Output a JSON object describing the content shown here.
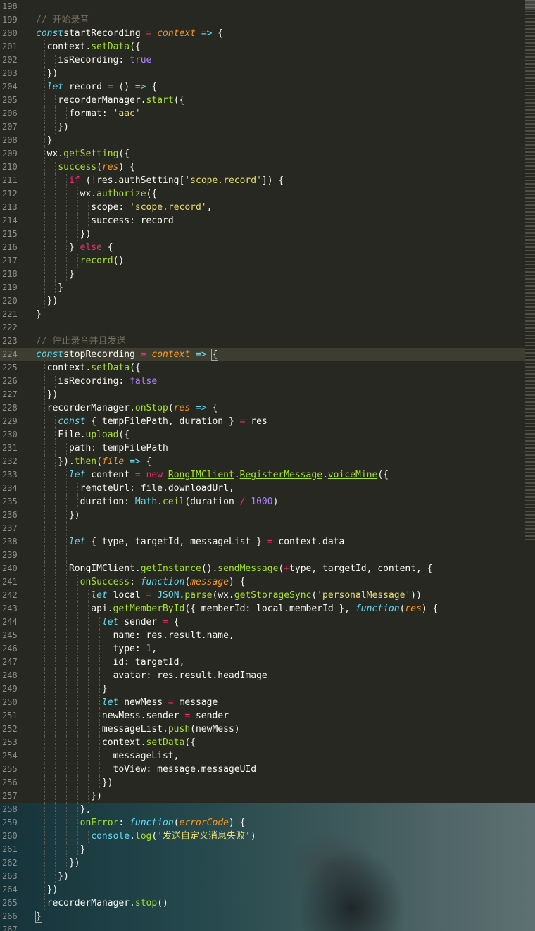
{
  "editor": {
    "current_line": 224,
    "lines": [
      {
        "n": "198",
        "i": 0,
        "t": []
      },
      {
        "n": "199",
        "i": 0,
        "t": [
          [
            "c",
            "// 开始录音"
          ]
        ]
      },
      {
        "n": "200",
        "i": 0,
        "t": [
          [
            "k",
            "const"
          ],
          [
            "",
            "startRecording "
          ],
          [
            "r",
            "="
          ],
          [
            "",
            " "
          ],
          [
            "p",
            "context"
          ],
          [
            "",
            " "
          ],
          [
            "k",
            "=>"
          ],
          [
            "",
            " {"
          ]
        ]
      },
      {
        "n": "201",
        "i": 1,
        "t": [
          [
            "",
            "  context."
          ],
          [
            "f",
            "setData"
          ],
          [
            "",
            "({"
          ]
        ]
      },
      {
        "n": "202",
        "i": 2,
        "t": [
          [
            "",
            "    isRecording: "
          ],
          [
            "n",
            "true"
          ]
        ]
      },
      {
        "n": "203",
        "i": 1,
        "t": [
          [
            "",
            "  })"
          ]
        ]
      },
      {
        "n": "204",
        "i": 1,
        "t": [
          [
            "",
            "  "
          ],
          [
            "k",
            "let"
          ],
          [
            "",
            " record "
          ],
          [
            "r",
            "="
          ],
          [
            "",
            " () "
          ],
          [
            "k",
            "=>"
          ],
          [
            "",
            " {"
          ]
        ]
      },
      {
        "n": "205",
        "i": 2,
        "t": [
          [
            "",
            "    recorderManager."
          ],
          [
            "f",
            "start"
          ],
          [
            "",
            "({"
          ]
        ]
      },
      {
        "n": "206",
        "i": 3,
        "t": [
          [
            "",
            "      format: "
          ],
          [
            "s",
            "'aac'"
          ]
        ]
      },
      {
        "n": "207",
        "i": 2,
        "t": [
          [
            "",
            "    })"
          ]
        ]
      },
      {
        "n": "208",
        "i": 1,
        "t": [
          [
            "",
            "  }"
          ]
        ]
      },
      {
        "n": "209",
        "i": 1,
        "t": [
          [
            "",
            "  wx."
          ],
          [
            "f",
            "getSetting"
          ],
          [
            "",
            "({"
          ]
        ]
      },
      {
        "n": "210",
        "i": 2,
        "t": [
          [
            "",
            "    "
          ],
          [
            "f",
            "success"
          ],
          [
            "",
            "("
          ],
          [
            "p",
            "res"
          ],
          [
            "",
            ") {"
          ]
        ]
      },
      {
        "n": "211",
        "i": 3,
        "t": [
          [
            "",
            "      "
          ],
          [
            "r",
            "if"
          ],
          [
            "",
            " ("
          ],
          [
            "r",
            "!"
          ],
          [
            "",
            "res.authSetting["
          ],
          [
            "s",
            "'scope.record'"
          ],
          [
            "",
            "]) {"
          ]
        ]
      },
      {
        "n": "212",
        "i": 4,
        "t": [
          [
            "",
            "        wx."
          ],
          [
            "f",
            "authorize"
          ],
          [
            "",
            "({"
          ]
        ]
      },
      {
        "n": "213",
        "i": 5,
        "t": [
          [
            "",
            "          scope: "
          ],
          [
            "s",
            "'scope.record'"
          ],
          [
            "",
            ","
          ]
        ]
      },
      {
        "n": "214",
        "i": 5,
        "t": [
          [
            "",
            "          success: record"
          ]
        ]
      },
      {
        "n": "215",
        "i": 4,
        "t": [
          [
            "",
            "        })"
          ]
        ]
      },
      {
        "n": "216",
        "i": 3,
        "t": [
          [
            "",
            "      } "
          ],
          [
            "r",
            "else"
          ],
          [
            "",
            " {"
          ]
        ]
      },
      {
        "n": "217",
        "i": 4,
        "t": [
          [
            "",
            "        "
          ],
          [
            "f",
            "record"
          ],
          [
            "",
            "()"
          ]
        ]
      },
      {
        "n": "218",
        "i": 3,
        "t": [
          [
            "",
            "      }"
          ]
        ]
      },
      {
        "n": "219",
        "i": 2,
        "t": [
          [
            "",
            "    }"
          ]
        ]
      },
      {
        "n": "220",
        "i": 1,
        "t": [
          [
            "",
            "  })"
          ]
        ]
      },
      {
        "n": "221",
        "i": 0,
        "t": [
          [
            "",
            "}"
          ]
        ]
      },
      {
        "n": "222",
        "i": 0,
        "t": []
      },
      {
        "n": "223",
        "i": 0,
        "t": [
          [
            "c",
            "// 停止录音并且发送"
          ]
        ]
      },
      {
        "n": "224",
        "i": 0,
        "t": [
          [
            "k",
            "const"
          ],
          [
            "",
            "stopRecording "
          ],
          [
            "r",
            "="
          ],
          [
            "",
            " "
          ],
          [
            "p",
            "context"
          ],
          [
            "",
            " "
          ],
          [
            "k",
            "=>"
          ],
          [
            "",
            " "
          ],
          [
            "ou",
            "{"
          ]
        ]
      },
      {
        "n": "225",
        "i": 1,
        "t": [
          [
            "",
            "  context."
          ],
          [
            "f",
            "setData"
          ],
          [
            "",
            "({"
          ]
        ]
      },
      {
        "n": "226",
        "i": 2,
        "t": [
          [
            "",
            "    isRecording: "
          ],
          [
            "n",
            "false"
          ]
        ]
      },
      {
        "n": "227",
        "i": 1,
        "t": [
          [
            "",
            "  })"
          ]
        ]
      },
      {
        "n": "228",
        "i": 1,
        "t": [
          [
            "",
            "  recorderManager."
          ],
          [
            "f",
            "onStop"
          ],
          [
            "",
            "("
          ],
          [
            "p",
            "res"
          ],
          [
            "",
            " "
          ],
          [
            "k",
            "=>"
          ],
          [
            "",
            " {"
          ]
        ]
      },
      {
        "n": "229",
        "i": 2,
        "t": [
          [
            "",
            "    "
          ],
          [
            "k",
            "const"
          ],
          [
            "",
            " { tempFilePath, duration } "
          ],
          [
            "r",
            "="
          ],
          [
            "",
            " res"
          ]
        ]
      },
      {
        "n": "230",
        "i": 2,
        "t": [
          [
            "",
            "    File."
          ],
          [
            "f",
            "upload"
          ],
          [
            "",
            "({"
          ]
        ]
      },
      {
        "n": "231",
        "i": 3,
        "t": [
          [
            "",
            "      path: tempFilePath"
          ]
        ]
      },
      {
        "n": "232",
        "i": 2,
        "t": [
          [
            "",
            "    })."
          ],
          [
            "f",
            "then"
          ],
          [
            "",
            "("
          ],
          [
            "p",
            "file"
          ],
          [
            "",
            " "
          ],
          [
            "k",
            "=>"
          ],
          [
            "",
            " {"
          ]
        ]
      },
      {
        "n": "233",
        "i": 3,
        "t": [
          [
            "",
            "      "
          ],
          [
            "k",
            "let"
          ],
          [
            "",
            " content "
          ],
          [
            "r",
            "="
          ],
          [
            "",
            " "
          ],
          [
            "r",
            "new"
          ],
          [
            "",
            " "
          ],
          [
            "cl",
            "RongIMClient"
          ],
          [
            "",
            "."
          ],
          [
            "cl",
            "RegisterMessage"
          ],
          [
            "",
            "."
          ],
          [
            "cl",
            "voiceMine"
          ],
          [
            "",
            "({"
          ]
        ]
      },
      {
        "n": "234",
        "i": 4,
        "t": [
          [
            "",
            "        remoteUrl: file.downloadUrl,"
          ]
        ]
      },
      {
        "n": "235",
        "i": 4,
        "t": [
          [
            "",
            "        duration: "
          ],
          [
            "bi",
            "Math"
          ],
          [
            "",
            "."
          ],
          [
            "f",
            "ceil"
          ],
          [
            "",
            "(duration "
          ],
          [
            "r",
            "/"
          ],
          [
            "",
            " "
          ],
          [
            "n",
            "1000"
          ],
          [
            "",
            ")"
          ]
        ]
      },
      {
        "n": "236",
        "i": 3,
        "t": [
          [
            "",
            "      })"
          ]
        ]
      },
      {
        "n": "237",
        "i": 3,
        "t": []
      },
      {
        "n": "238",
        "i": 3,
        "t": [
          [
            "",
            "      "
          ],
          [
            "k",
            "let"
          ],
          [
            "",
            " { type, targetId, messageList } "
          ],
          [
            "r",
            "="
          ],
          [
            "",
            " context.data"
          ]
        ]
      },
      {
        "n": "239",
        "i": 3,
        "t": []
      },
      {
        "n": "240",
        "i": 3,
        "t": [
          [
            "",
            "      RongIMClient."
          ],
          [
            "f",
            "getInstance"
          ],
          [
            "",
            "()."
          ],
          [
            "f",
            "sendMessage"
          ],
          [
            "",
            "("
          ],
          [
            "r",
            "+"
          ],
          [
            "",
            "type, targetId, content, {"
          ]
        ]
      },
      {
        "n": "241",
        "i": 4,
        "t": [
          [
            "",
            "        "
          ],
          [
            "f",
            "onSuccess"
          ],
          [
            "",
            ": "
          ],
          [
            "k",
            "function"
          ],
          [
            "",
            "("
          ],
          [
            "p",
            "message"
          ],
          [
            "",
            ") {"
          ]
        ]
      },
      {
        "n": "242",
        "i": 5,
        "t": [
          [
            "",
            "          "
          ],
          [
            "k",
            "let"
          ],
          [
            "",
            " local "
          ],
          [
            "r",
            "="
          ],
          [
            "",
            " "
          ],
          [
            "bi",
            "JSON"
          ],
          [
            "",
            "."
          ],
          [
            "f",
            "parse"
          ],
          [
            "",
            "(wx."
          ],
          [
            "f",
            "getStorageSync"
          ],
          [
            "",
            "("
          ],
          [
            "s",
            "'personalMessage'"
          ],
          [
            "",
            "))"
          ]
        ]
      },
      {
        "n": "243",
        "i": 5,
        "t": [
          [
            "",
            "          api."
          ],
          [
            "f",
            "getMemberById"
          ],
          [
            "",
            "({ memberId: local.memberId }, "
          ],
          [
            "k",
            "function"
          ],
          [
            "",
            "("
          ],
          [
            "p",
            "res"
          ],
          [
            "",
            ") {"
          ]
        ]
      },
      {
        "n": "244",
        "i": 6,
        "t": [
          [
            "",
            "            "
          ],
          [
            "k",
            "let"
          ],
          [
            "",
            " sender "
          ],
          [
            "r",
            "="
          ],
          [
            "",
            " {"
          ]
        ]
      },
      {
        "n": "245",
        "i": 7,
        "t": [
          [
            "",
            "              name: res.result.name,"
          ]
        ]
      },
      {
        "n": "246",
        "i": 7,
        "t": [
          [
            "",
            "              type: "
          ],
          [
            "n",
            "1"
          ],
          [
            "",
            ","
          ]
        ]
      },
      {
        "n": "247",
        "i": 7,
        "t": [
          [
            "",
            "              id: targetId,"
          ]
        ]
      },
      {
        "n": "248",
        "i": 7,
        "t": [
          [
            "",
            "              avatar: res.result.headImage"
          ]
        ]
      },
      {
        "n": "249",
        "i": 6,
        "t": [
          [
            "",
            "            }"
          ]
        ]
      },
      {
        "n": "250",
        "i": 6,
        "t": [
          [
            "",
            "            "
          ],
          [
            "k",
            "let"
          ],
          [
            "",
            " newMess "
          ],
          [
            "r",
            "="
          ],
          [
            "",
            " message"
          ]
        ]
      },
      {
        "n": "251",
        "i": 6,
        "t": [
          [
            "",
            "            newMess.sender "
          ],
          [
            "r",
            "="
          ],
          [
            "",
            " sender"
          ]
        ]
      },
      {
        "n": "252",
        "i": 6,
        "t": [
          [
            "",
            "            messageList."
          ],
          [
            "f",
            "push"
          ],
          [
            "",
            "(newMess)"
          ]
        ]
      },
      {
        "n": "253",
        "i": 6,
        "t": [
          [
            "",
            "            context."
          ],
          [
            "f",
            "setData"
          ],
          [
            "",
            "({"
          ]
        ]
      },
      {
        "n": "254",
        "i": 7,
        "t": [
          [
            "",
            "              messageList,"
          ]
        ]
      },
      {
        "n": "255",
        "i": 7,
        "t": [
          [
            "",
            "              toView: message.messageUId"
          ]
        ]
      },
      {
        "n": "256",
        "i": 6,
        "t": [
          [
            "",
            "            })"
          ]
        ]
      },
      {
        "n": "257",
        "i": 5,
        "t": [
          [
            "",
            "          })"
          ]
        ]
      },
      {
        "n": "258",
        "i": 4,
        "t": [
          [
            "",
            "        },"
          ]
        ]
      },
      {
        "n": "259",
        "i": 4,
        "t": [
          [
            "",
            "        "
          ],
          [
            "f",
            "onError"
          ],
          [
            "",
            ": "
          ],
          [
            "k",
            "function"
          ],
          [
            "",
            "("
          ],
          [
            "p",
            "errorCode"
          ],
          [
            "",
            ") {"
          ]
        ]
      },
      {
        "n": "260",
        "i": 5,
        "t": [
          [
            "",
            "          "
          ],
          [
            "bi",
            "console"
          ],
          [
            "",
            "."
          ],
          [
            "f",
            "log"
          ],
          [
            "",
            "("
          ],
          [
            "s",
            "'发送自定义消息失败'"
          ],
          [
            "",
            ")"
          ]
        ]
      },
      {
        "n": "261",
        "i": 4,
        "t": [
          [
            "",
            "        }"
          ]
        ]
      },
      {
        "n": "262",
        "i": 3,
        "t": [
          [
            "",
            "      })"
          ]
        ]
      },
      {
        "n": "263",
        "i": 2,
        "t": [
          [
            "",
            "    })"
          ]
        ]
      },
      {
        "n": "264",
        "i": 1,
        "t": [
          [
            "",
            "  })"
          ]
        ]
      },
      {
        "n": "265",
        "i": 1,
        "t": [
          [
            "",
            "  recorderManager."
          ],
          [
            "f",
            "stop"
          ],
          [
            "",
            "()"
          ]
        ]
      },
      {
        "n": "266",
        "i": 0,
        "t": [
          [
            "ou",
            "}"
          ]
        ]
      },
      {
        "n": "267",
        "i": 0,
        "t": []
      }
    ]
  }
}
